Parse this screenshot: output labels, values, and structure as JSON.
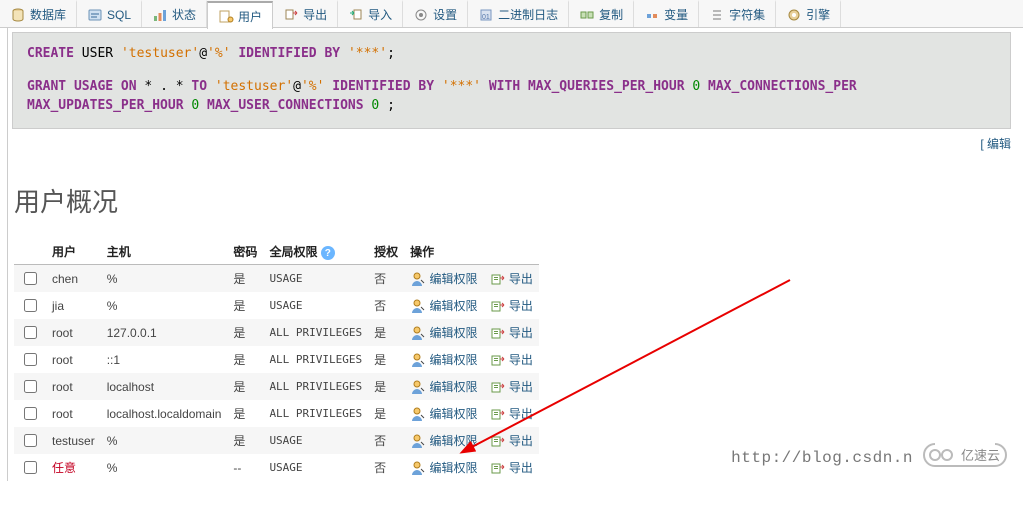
{
  "tabs": {
    "database": "数据库",
    "sql": "SQL",
    "status": "状态",
    "users": "用户",
    "export": "导出",
    "import": "导入",
    "settings": "设置",
    "binlog": "二进制日志",
    "replication": "复制",
    "variables": "变量",
    "charset": "字符集",
    "engines": "引擎"
  },
  "sql": {
    "createuser": "CREATE",
    "user": "USER",
    "lit_user": "'testuser'",
    "at": "@",
    "lit_host": "'%'",
    "identby": "IDENTIFIED BY",
    "pwd": "'***'",
    "grant": "GRANT",
    "usage": "USAGE ON",
    "star": "* . *",
    "to": "TO",
    "with": "WITH",
    "mq": "MAX_QUERIES_PER_HOUR",
    "mc": "MAX_CONNECTIONS_PER",
    "mu": "MAX_UPDATES_PER_HOUR",
    "muc": "MAX_USER_CONNECTIONS",
    "zero": "0",
    "semi": ";"
  },
  "editlink": "[ 编辑",
  "header": "用户概况",
  "cols": {
    "user": "用户",
    "host": "主机",
    "pwd": "密码",
    "globalpriv": "全局权限",
    "grant": "授权",
    "action": "操作"
  },
  "vals": {
    "yes": "是",
    "no": "否",
    "dash": "--",
    "usage": "USAGE",
    "allpriv": "ALL PRIVILEGES",
    "editpriv": "编辑权限",
    "export": "导出"
  },
  "rows": [
    {
      "u": "chen",
      "h": "%",
      "p": "yes",
      "gp": "usage",
      "gr": "no"
    },
    {
      "u": "jia",
      "h": "%",
      "p": "yes",
      "gp": "usage",
      "gr": "no"
    },
    {
      "u": "root",
      "h": "127.0.0.1",
      "p": "yes",
      "gp": "allpriv",
      "gr": "yes"
    },
    {
      "u": "root",
      "h": "::1",
      "p": "yes",
      "gp": "allpriv",
      "gr": "yes"
    },
    {
      "u": "root",
      "h": "localhost",
      "p": "yes",
      "gp": "allpriv",
      "gr": "yes"
    },
    {
      "u": "root",
      "h": "localhost.localdomain",
      "p": "yes",
      "gp": "allpriv",
      "gr": "yes"
    },
    {
      "u": "testuser",
      "h": "%",
      "p": "yes",
      "gp": "usage",
      "gr": "no"
    },
    {
      "u": "任意",
      "h": "%",
      "p": "dash",
      "gp": "usage",
      "gr": "no",
      "danger": true
    }
  ],
  "watermark": "http://blog.csdn.n",
  "watermark2": "亿速云"
}
